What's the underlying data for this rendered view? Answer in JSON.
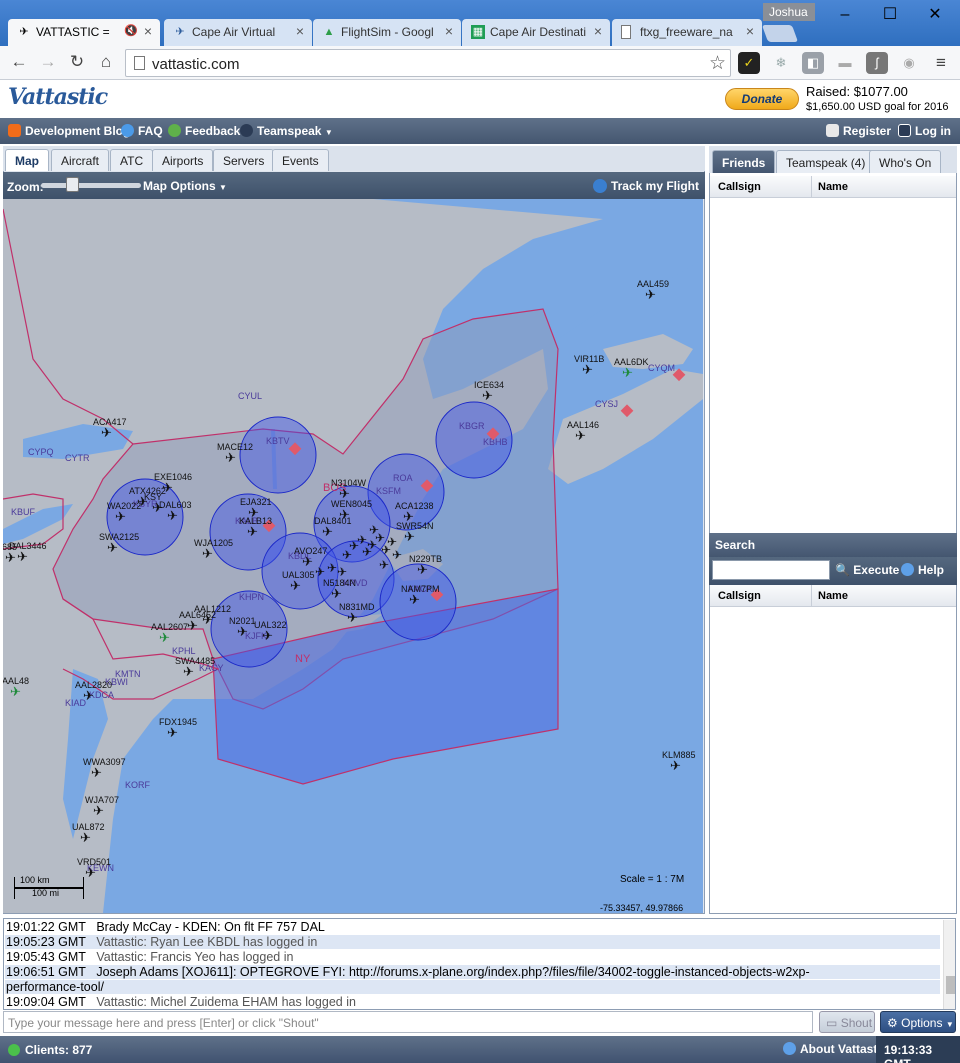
{
  "browser": {
    "tabs": [
      {
        "label": "VATTASTIC = ",
        "active": true
      },
      {
        "label": "Cape Air Virtual",
        "active": false
      },
      {
        "label": "FlightSim - Googl",
        "active": false
      },
      {
        "label": "Cape Air Destinati",
        "active": false
      },
      {
        "label": "ftxg_freeware_na",
        "active": false
      }
    ],
    "user": "Joshua",
    "url": "vattastic.com"
  },
  "site": {
    "logo": "Vattastic",
    "donate_label": "Donate",
    "raised": "Raised: $1077.00",
    "goal": "$1,650.00 USD goal for 2016",
    "nav": {
      "dev_blog": "Development Blog",
      "faq": "FAQ",
      "feedback": "Feedback",
      "teamspeak": "Teamspeak",
      "register": "Register",
      "login": "Log in"
    }
  },
  "left_tabs": [
    "Map",
    "Aircraft",
    "ATC",
    "Airports",
    "Servers",
    "Events"
  ],
  "map_toolbar": {
    "zoom_label": "Zoom:",
    "map_options": "Map Options",
    "track_flight": "Track my Flight"
  },
  "map": {
    "scale": "Scale = 1 : 7M",
    "coords": "-75.33457, 49.97866",
    "scalebar_km": "100 km",
    "scalebar_mi": "100 mi",
    "region_labels": [
      "BOS",
      "NY"
    ],
    "atc_circles": [
      "KBTV",
      "KBGR",
      "KBHB",
      "KSYR",
      "KALB",
      "ROA",
      "KSFM",
      "KBDL",
      "KPVD",
      "KACK",
      "KHPN",
      "KJFK"
    ],
    "airport_labels": [
      "CYQM",
      "CYSJ",
      "CYUL",
      "CYTR",
      "CYPQ",
      "KBUF",
      "KMTN",
      "KBWI",
      "KDCA",
      "KIAD",
      "KORF",
      "KEWN",
      "KACY",
      "KPHL"
    ],
    "flights": [
      "AAL459",
      "VIR11B",
      "AAL6DK",
      "ICE634",
      "AAL146",
      "ACA417",
      "MACE12",
      "EXE1046",
      "ATX4262",
      "KSY",
      "WA2022",
      "DAL603",
      "EJA321",
      "WJA1205",
      "KALB13",
      "N3104W",
      "WEN8045",
      "DAL8401",
      "AVO247",
      "UAL305",
      "N5184N",
      "N831MD",
      "ACA1238",
      "SWR54N",
      "N229TB",
      "NAM7PM",
      "AAL1212",
      "AAL6452",
      "AAL2607",
      "UAL322",
      "N2021",
      "SWA4485",
      "AAL48",
      "AAL2820",
      "FDX1945",
      "WWA3097",
      "WJA707",
      "UAL872",
      "VRD501",
      "KLM885",
      "SWA2125",
      "1685",
      "DAL3446"
    ]
  },
  "right_tabs": [
    {
      "label": "Friends",
      "active": true
    },
    {
      "label": "Teamspeak (4)",
      "active": false
    },
    {
      "label": "Who's On",
      "active": false
    }
  ],
  "friends_columns": [
    "Callsign",
    "Name"
  ],
  "search": {
    "title": "Search",
    "execute": "Execute",
    "help": "Help",
    "columns": [
      "Callsign",
      "Name"
    ]
  },
  "chat": {
    "lines": [
      {
        "time": "19:01:22 GMT",
        "text": "Brady McCay - KDEN: On flt FF 757 DAL",
        "system": false
      },
      {
        "time": "19:05:23 GMT",
        "text": "Vattastic: Ryan Lee KBDL has logged in",
        "system": true
      },
      {
        "time": "19:05:43 GMT",
        "text": "Vattastic: Francis Yeo has logged in",
        "system": true
      },
      {
        "time": "19:06:51 GMT",
        "text": "Joseph Adams [XOJ611]: OPTEGROVE FYI: http://forums.x-plane.org/index.php?/files/file/34002-toggle-instanced-objects-w2xp-",
        "system": false
      },
      {
        "time": "",
        "text": "performance-tool/",
        "system": false
      },
      {
        "time": "19:09:04 GMT",
        "text": "Vattastic: Michel Zuidema EHAM has logged in",
        "system": true
      }
    ],
    "input_placeholder": "Type your message here and press [Enter] or click \"Shout\"",
    "shout": "Shout",
    "options": "Options"
  },
  "footer": {
    "clients": "Clients: 877",
    "about": "About Vattastic",
    "clock": "19:13:33 GMT"
  },
  "colors": {
    "nav_bar": "#4f6079",
    "water": "#7aa8e3",
    "land": "#b6bcc6",
    "atc_fill": "#3e55e8",
    "boundary": "#c0306a"
  }
}
